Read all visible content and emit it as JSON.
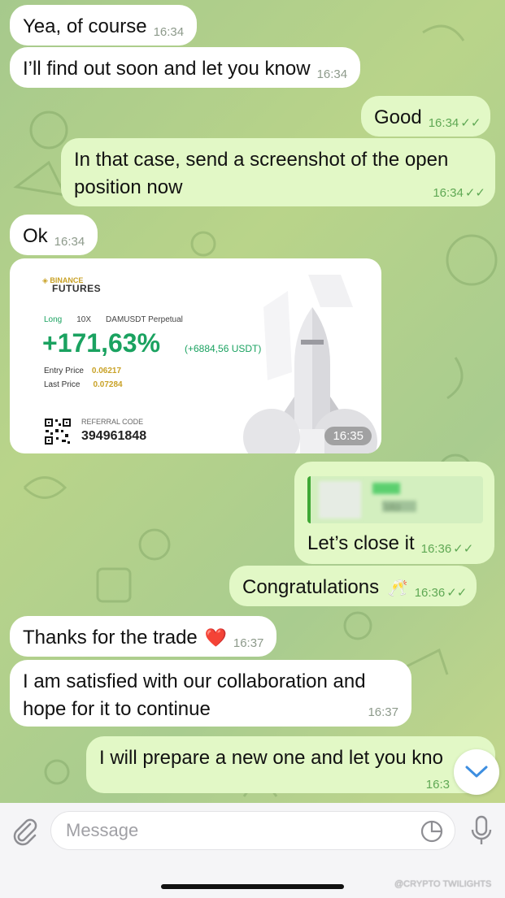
{
  "messages": [
    {
      "text": "Yea, of course",
      "time": "16:34"
    },
    {
      "text": "I’ll find out soon and let you know",
      "time": "16:34"
    },
    {
      "text": "Good",
      "time": "16:34"
    },
    {
      "text_line1": "In that case, send a screenshot of the open",
      "text_line2": "position now",
      "time": "16:34"
    },
    {
      "text": "Ok",
      "time": "16:34"
    },
    {
      "text": "Let’s close it",
      "time": "16:36"
    },
    {
      "text": "Congratulations",
      "emoji": "🥂",
      "time": "16:36"
    },
    {
      "text": "Thanks for the trade",
      "emoji": "❤️",
      "time": "16:37"
    },
    {
      "text_line1": "I am satisfied with our collaboration and",
      "text_line2": "hope for it to continue",
      "time": "16:37"
    },
    {
      "text": "I will prepare a new one and let you kno",
      "time": "16:3"
    }
  ],
  "read_receipt": "✓✓",
  "futures_card": {
    "brand": "BINANCE",
    "product": "FUTURES",
    "side": "Long",
    "leverage": "10X",
    "pair": "DAMUSDT Perpetual",
    "pnl_percent": "+171,63%",
    "pnl_usdt": "(+6884,56 USDT)",
    "entry_label": "Entry Price",
    "entry_value": "0.06217",
    "last_label": "Last Price",
    "last_value": "0.07284",
    "referral_label": "REFERRAL CODE",
    "referral_code": "394961848",
    "time": "16:35"
  },
  "reply_preview": {
    "snippet": "’oto"
  },
  "input": {
    "placeholder": "Message"
  },
  "watermark": "@CRYPTO TWILIGHTS",
  "colors": {
    "outgoing_bubble": "#e2f8c6",
    "incoming_bubble": "#ffffff",
    "check_green": "#5fa854",
    "profit_green": "#1aa260"
  }
}
